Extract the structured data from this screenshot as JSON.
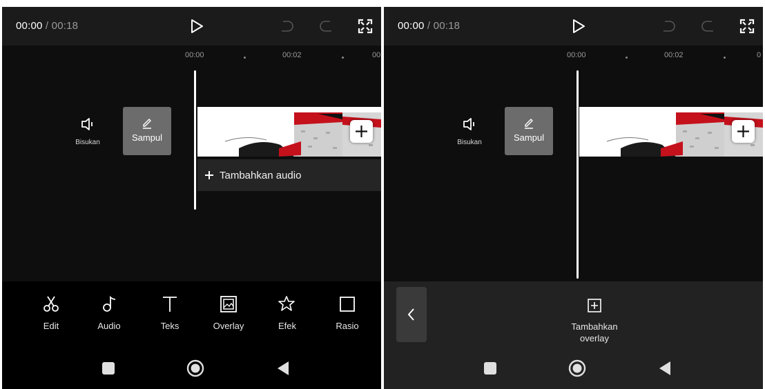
{
  "left": {
    "time_current": "00:00",
    "time_total": " / 00:18",
    "ruler": [
      "00:00",
      "00:02",
      "00"
    ],
    "mute_label": "Bisukan",
    "cover_label": "Sampul",
    "add_audio_label": "Tambahkan audio",
    "tools": [
      {
        "label": "Edit",
        "icon": "scissors-icon"
      },
      {
        "label": "Audio",
        "icon": "music-note-icon"
      },
      {
        "label": "Teks",
        "icon": "text-icon"
      },
      {
        "label": "Overlay",
        "icon": "overlay-icon"
      },
      {
        "label": "Efek",
        "icon": "effect-star-icon"
      },
      {
        "label": "Rasio",
        "icon": "ratio-square-icon"
      }
    ]
  },
  "right": {
    "time_current": "00:00",
    "time_total": " / 00:18",
    "ruler": [
      "00:00",
      "00:02",
      "0"
    ],
    "mute_label": "Bisukan",
    "cover_label": "Sampul",
    "add_overlay_label_1": "Tambahkan",
    "add_overlay_label_2": "overlay"
  },
  "colors": {
    "panel_bg": "#0e0e0e",
    "topbar_bg": "#1b1b1b",
    "overlay_toolbar_bg": "#222222",
    "cover_bg": "#6c6c6c",
    "clip_red": "#c4111c"
  }
}
